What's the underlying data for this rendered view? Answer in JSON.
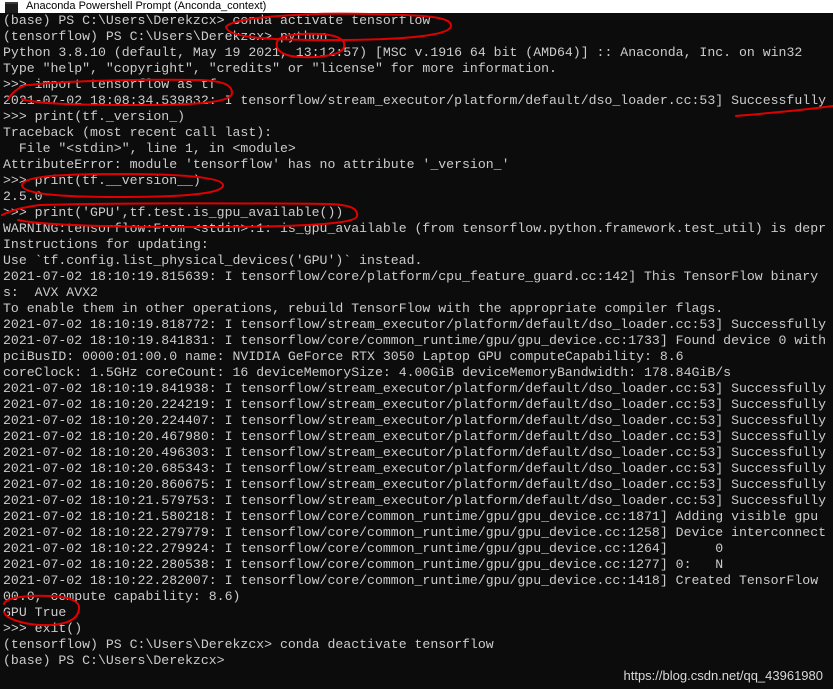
{
  "window": {
    "title": "Anaconda Powershell Prompt (Anconda_context)"
  },
  "console": {
    "lines": [
      "(base) PS C:\\Users\\Derekzcx> conda activate tensorflow",
      "(tensorflow) PS C:\\Users\\Derekzcx> python",
      "Python 3.8.10 (default, May 19 2021, 13:12:57) [MSC v.1916 64 bit (AMD64)] :: Anaconda, Inc. on win32",
      "Type \"help\", \"copyright\", \"credits\" or \"license\" for more information.",
      ">>> import tensorflow as tf",
      "2021-07-02 18:08:34.539832: I tensorflow/stream_executor/platform/default/dso_loader.cc:53] Successfully",
      ">>> print(tf._version_)",
      "Traceback (most recent call last):",
      "  File \"<stdin>\", line 1, in <module>",
      "AttributeError: module 'tensorflow' has no attribute '_version_'",
      ">>> print(tf.__version__)",
      "2.5.0",
      ">>> print('GPU',tf.test.is_gpu_available())",
      "WARNING:tensorflow:From <stdin>:1: is_gpu_available (from tensorflow.python.framework.test_util) is depr",
      "Instructions for updating:",
      "Use `tf.config.list_physical_devices('GPU')` instead.",
      "2021-07-02 18:10:19.815639: I tensorflow/core/platform/cpu_feature_guard.cc:142] This TensorFlow binary",
      "s:  AVX AVX2",
      "To enable them in other operations, rebuild TensorFlow with the appropriate compiler flags.",
      "2021-07-02 18:10:19.818772: I tensorflow/stream_executor/platform/default/dso_loader.cc:53] Successfully",
      "2021-07-02 18:10:19.841831: I tensorflow/core/common_runtime/gpu/gpu_device.cc:1733] Found device 0 with",
      "pciBusID: 0000:01:00.0 name: NVIDIA GeForce RTX 3050 Laptop GPU computeCapability: 8.6",
      "coreClock: 1.5GHz coreCount: 16 deviceMemorySize: 4.00GiB deviceMemoryBandwidth: 178.84GiB/s",
      "2021-07-02 18:10:19.841938: I tensorflow/stream_executor/platform/default/dso_loader.cc:53] Successfully",
      "2021-07-02 18:10:20.224219: I tensorflow/stream_executor/platform/default/dso_loader.cc:53] Successfully",
      "2021-07-02 18:10:20.224407: I tensorflow/stream_executor/platform/default/dso_loader.cc:53] Successfully",
      "2021-07-02 18:10:20.467980: I tensorflow/stream_executor/platform/default/dso_loader.cc:53] Successfully",
      "2021-07-02 18:10:20.496303: I tensorflow/stream_executor/platform/default/dso_loader.cc:53] Successfully",
      "2021-07-02 18:10:20.685343: I tensorflow/stream_executor/platform/default/dso_loader.cc:53] Successfully",
      "2021-07-02 18:10:20.860675: I tensorflow/stream_executor/platform/default/dso_loader.cc:53] Successfully",
      "2021-07-02 18:10:21.579753: I tensorflow/stream_executor/platform/default/dso_loader.cc:53] Successfully",
      "2021-07-02 18:10:21.580218: I tensorflow/core/common_runtime/gpu/gpu_device.cc:1871] Adding visible gpu",
      "2021-07-02 18:10:22.279779: I tensorflow/core/common_runtime/gpu/gpu_device.cc:1258] Device interconnect",
      "2021-07-02 18:10:22.279924: I tensorflow/core/common_runtime/gpu/gpu_device.cc:1264]      0",
      "2021-07-02 18:10:22.280538: I tensorflow/core/common_runtime/gpu/gpu_device.cc:1277] 0:   N",
      "2021-07-02 18:10:22.282007: I tensorflow/core/common_runtime/gpu/gpu_device.cc:1418] Created TensorFlow",
      "00.0, compute capability: 8.6)",
      "GPU True",
      ">>> exit()",
      "(tensorflow) PS C:\\Users\\Derekzcx> conda deactivate tensorflow",
      "(base) PS C:\\Users\\Derekzcx>"
    ]
  },
  "watermark": "https://blog.csdn.net/qq_43961980",
  "colors": {
    "background": "#0c0c0c",
    "text": "#cccccc",
    "titlebar": "#ffffff",
    "annotation": "#e00000"
  }
}
